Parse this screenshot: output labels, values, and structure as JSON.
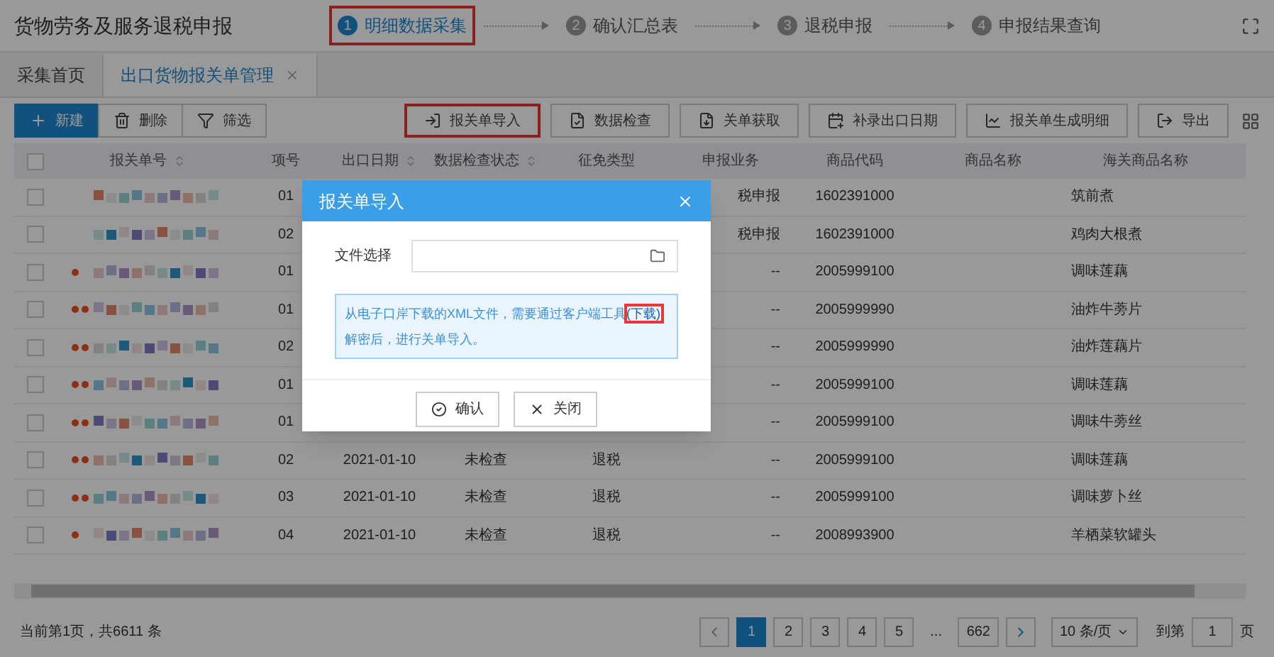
{
  "app_title": "货物劳务及服务退税申报",
  "steps": [
    {
      "number": "1",
      "label": "明细数据采集",
      "selected": true,
      "highlighted": true
    },
    {
      "number": "2",
      "label": "确认汇总表",
      "selected": false,
      "highlighted": false
    },
    {
      "number": "3",
      "label": "退税申报",
      "selected": false,
      "highlighted": false
    },
    {
      "number": "4",
      "label": "申报结果查询",
      "selected": false,
      "highlighted": false
    }
  ],
  "tabs": [
    {
      "label": "采集首页",
      "selected": false,
      "closable": false
    },
    {
      "label": "出口货物报关单管理",
      "selected": true,
      "closable": true
    }
  ],
  "toolbar_left": [
    {
      "kind": "add",
      "label": "新建",
      "primary": true
    },
    {
      "kind": "delete",
      "label": "删除",
      "primary": false
    },
    {
      "kind": "filter",
      "label": "筛选",
      "primary": false
    }
  ],
  "toolbar_right": [
    {
      "kind": "import",
      "label": "报关单导入",
      "highlighted": true
    },
    {
      "kind": "check",
      "label": "数据检查",
      "highlighted": false
    },
    {
      "kind": "fetch",
      "label": "关单获取",
      "highlighted": false
    },
    {
      "kind": "date",
      "label": "补录出口日期",
      "highlighted": false
    },
    {
      "kind": "chart",
      "label": "报关单生成明细",
      "highlighted": false
    },
    {
      "kind": "export",
      "label": "导出",
      "highlighted": false
    }
  ],
  "table": {
    "header_checked": false,
    "columns": [
      {
        "label": "报关单号",
        "sortable": true
      },
      {
        "label": "项号",
        "sortable": false
      },
      {
        "label": "出口日期",
        "sortable": true
      },
      {
        "label": "数据检查状态",
        "sortable": true
      },
      {
        "label": "征免类型",
        "sortable": false
      },
      {
        "label": "申报业务",
        "sortable": false
      },
      {
        "label": "商品代码",
        "sortable": false
      },
      {
        "label": "商品名称",
        "sortable": false
      },
      {
        "label": "海关商品名称",
        "sortable": false
      }
    ],
    "rows": [
      {
        "checked": false,
        "item_no": "01",
        "business": "税申报",
        "goods_code": "1602391000",
        "customs_name": "筑前煮"
      },
      {
        "checked": false,
        "item_no": "02",
        "business": "税申报",
        "goods_code": "1602391000",
        "customs_name": "鸡肉大根煮"
      },
      {
        "checked": false,
        "item_no": "01",
        "business": "--",
        "goods_code": "2005999100",
        "customs_name": "调味莲藕"
      },
      {
        "checked": false,
        "item_no": "01",
        "business": "--",
        "goods_code": "2005999990",
        "customs_name": "油炸牛蒡片"
      },
      {
        "checked": false,
        "item_no": "02",
        "business": "--",
        "goods_code": "2005999990",
        "customs_name": "油炸莲藕片"
      },
      {
        "checked": false,
        "item_no": "01",
        "business": "--",
        "goods_code": "2005999100",
        "customs_name": "调味莲藕"
      },
      {
        "checked": false,
        "item_no": "01",
        "business": "--",
        "goods_code": "2005999100",
        "customs_name": "调味牛蒡丝"
      },
      {
        "checked": false,
        "item_no": "02",
        "export_date": "2021-01-10",
        "check_status": "未检查",
        "exemption": "退税",
        "business": "--",
        "goods_code": "2005999100",
        "customs_name": "调味莲藕"
      },
      {
        "checked": false,
        "item_no": "03",
        "export_date": "2021-01-10",
        "check_status": "未检查",
        "exemption": "退税",
        "business": "--",
        "goods_code": "2005999100",
        "customs_name": "调味萝卜丝"
      },
      {
        "checked": false,
        "item_no": "04",
        "export_date": "2021-01-10",
        "check_status": "未检查",
        "exemption": "退税",
        "business": "--",
        "goods_code": "2008993900",
        "customs_name": "羊栖菜软罐头"
      }
    ]
  },
  "footer": {
    "summary": "当前第1页，共6611 条",
    "pages": [
      {
        "label": "1",
        "selected": true
      },
      {
        "label": "2",
        "selected": false
      },
      {
        "label": "3",
        "selected": false
      },
      {
        "label": "4",
        "selected": false
      },
      {
        "label": "5",
        "selected": false
      },
      {
        "label": "...",
        "kind": "ellipsis"
      },
      {
        "label": "662",
        "selected": false
      }
    ],
    "page_size": "10 条/页",
    "goto_label": "到第",
    "goto_value": "1",
    "goto_suffix": "页"
  },
  "dialog": {
    "title": "报关单导入",
    "file_label": "文件选择",
    "notice_before": "从电子口岸下载的XML文件，需要通过客户端工具",
    "notice_link": "(下载)",
    "link_highlighted": true,
    "notice_after": "解密后，进行关单导入。",
    "buttons": [
      {
        "kind": "confirm",
        "label": "确认"
      },
      {
        "kind": "close",
        "label": "关闭"
      }
    ]
  }
}
